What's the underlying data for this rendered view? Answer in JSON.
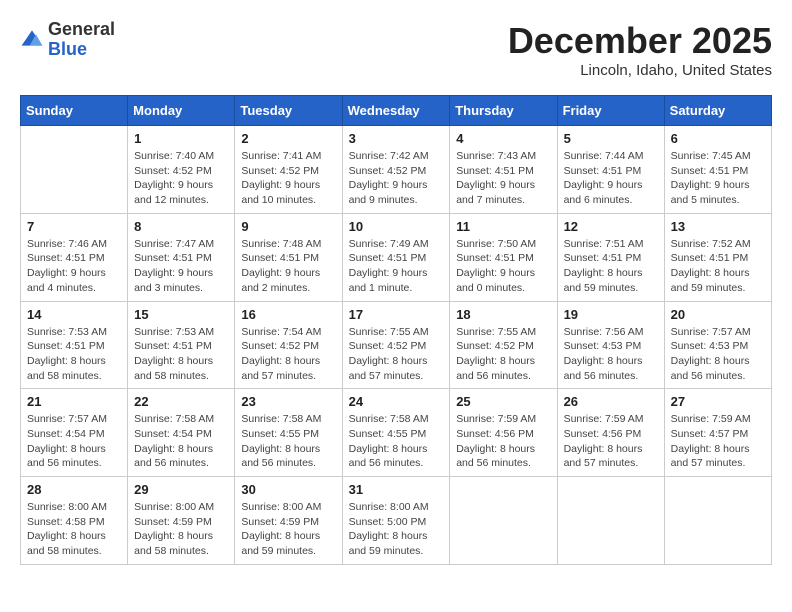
{
  "logo": {
    "general": "General",
    "blue": "Blue"
  },
  "header": {
    "month": "December 2025",
    "location": "Lincoln, Idaho, United States"
  },
  "weekdays": [
    "Sunday",
    "Monday",
    "Tuesday",
    "Wednesday",
    "Thursday",
    "Friday",
    "Saturday"
  ],
  "weeks": [
    [
      {
        "day": "",
        "info": ""
      },
      {
        "day": "1",
        "info": "Sunrise: 7:40 AM\nSunset: 4:52 PM\nDaylight: 9 hours\nand 12 minutes."
      },
      {
        "day": "2",
        "info": "Sunrise: 7:41 AM\nSunset: 4:52 PM\nDaylight: 9 hours\nand 10 minutes."
      },
      {
        "day": "3",
        "info": "Sunrise: 7:42 AM\nSunset: 4:52 PM\nDaylight: 9 hours\nand 9 minutes."
      },
      {
        "day": "4",
        "info": "Sunrise: 7:43 AM\nSunset: 4:51 PM\nDaylight: 9 hours\nand 7 minutes."
      },
      {
        "day": "5",
        "info": "Sunrise: 7:44 AM\nSunset: 4:51 PM\nDaylight: 9 hours\nand 6 minutes."
      },
      {
        "day": "6",
        "info": "Sunrise: 7:45 AM\nSunset: 4:51 PM\nDaylight: 9 hours\nand 5 minutes."
      }
    ],
    [
      {
        "day": "7",
        "info": "Sunrise: 7:46 AM\nSunset: 4:51 PM\nDaylight: 9 hours\nand 4 minutes."
      },
      {
        "day": "8",
        "info": "Sunrise: 7:47 AM\nSunset: 4:51 PM\nDaylight: 9 hours\nand 3 minutes."
      },
      {
        "day": "9",
        "info": "Sunrise: 7:48 AM\nSunset: 4:51 PM\nDaylight: 9 hours\nand 2 minutes."
      },
      {
        "day": "10",
        "info": "Sunrise: 7:49 AM\nSunset: 4:51 PM\nDaylight: 9 hours\nand 1 minute."
      },
      {
        "day": "11",
        "info": "Sunrise: 7:50 AM\nSunset: 4:51 PM\nDaylight: 9 hours\nand 0 minutes."
      },
      {
        "day": "12",
        "info": "Sunrise: 7:51 AM\nSunset: 4:51 PM\nDaylight: 8 hours\nand 59 minutes."
      },
      {
        "day": "13",
        "info": "Sunrise: 7:52 AM\nSunset: 4:51 PM\nDaylight: 8 hours\nand 59 minutes."
      }
    ],
    [
      {
        "day": "14",
        "info": "Sunrise: 7:53 AM\nSunset: 4:51 PM\nDaylight: 8 hours\nand 58 minutes."
      },
      {
        "day": "15",
        "info": "Sunrise: 7:53 AM\nSunset: 4:51 PM\nDaylight: 8 hours\nand 58 minutes."
      },
      {
        "day": "16",
        "info": "Sunrise: 7:54 AM\nSunset: 4:52 PM\nDaylight: 8 hours\nand 57 minutes."
      },
      {
        "day": "17",
        "info": "Sunrise: 7:55 AM\nSunset: 4:52 PM\nDaylight: 8 hours\nand 57 minutes."
      },
      {
        "day": "18",
        "info": "Sunrise: 7:55 AM\nSunset: 4:52 PM\nDaylight: 8 hours\nand 56 minutes."
      },
      {
        "day": "19",
        "info": "Sunrise: 7:56 AM\nSunset: 4:53 PM\nDaylight: 8 hours\nand 56 minutes."
      },
      {
        "day": "20",
        "info": "Sunrise: 7:57 AM\nSunset: 4:53 PM\nDaylight: 8 hours\nand 56 minutes."
      }
    ],
    [
      {
        "day": "21",
        "info": "Sunrise: 7:57 AM\nSunset: 4:54 PM\nDaylight: 8 hours\nand 56 minutes."
      },
      {
        "day": "22",
        "info": "Sunrise: 7:58 AM\nSunset: 4:54 PM\nDaylight: 8 hours\nand 56 minutes."
      },
      {
        "day": "23",
        "info": "Sunrise: 7:58 AM\nSunset: 4:55 PM\nDaylight: 8 hours\nand 56 minutes."
      },
      {
        "day": "24",
        "info": "Sunrise: 7:58 AM\nSunset: 4:55 PM\nDaylight: 8 hours\nand 56 minutes."
      },
      {
        "day": "25",
        "info": "Sunrise: 7:59 AM\nSunset: 4:56 PM\nDaylight: 8 hours\nand 56 minutes."
      },
      {
        "day": "26",
        "info": "Sunrise: 7:59 AM\nSunset: 4:56 PM\nDaylight: 8 hours\nand 57 minutes."
      },
      {
        "day": "27",
        "info": "Sunrise: 7:59 AM\nSunset: 4:57 PM\nDaylight: 8 hours\nand 57 minutes."
      }
    ],
    [
      {
        "day": "28",
        "info": "Sunrise: 8:00 AM\nSunset: 4:58 PM\nDaylight: 8 hours\nand 58 minutes."
      },
      {
        "day": "29",
        "info": "Sunrise: 8:00 AM\nSunset: 4:59 PM\nDaylight: 8 hours\nand 58 minutes."
      },
      {
        "day": "30",
        "info": "Sunrise: 8:00 AM\nSunset: 4:59 PM\nDaylight: 8 hours\nand 59 minutes."
      },
      {
        "day": "31",
        "info": "Sunrise: 8:00 AM\nSunset: 5:00 PM\nDaylight: 8 hours\nand 59 minutes."
      },
      {
        "day": "",
        "info": ""
      },
      {
        "day": "",
        "info": ""
      },
      {
        "day": "",
        "info": ""
      }
    ]
  ]
}
